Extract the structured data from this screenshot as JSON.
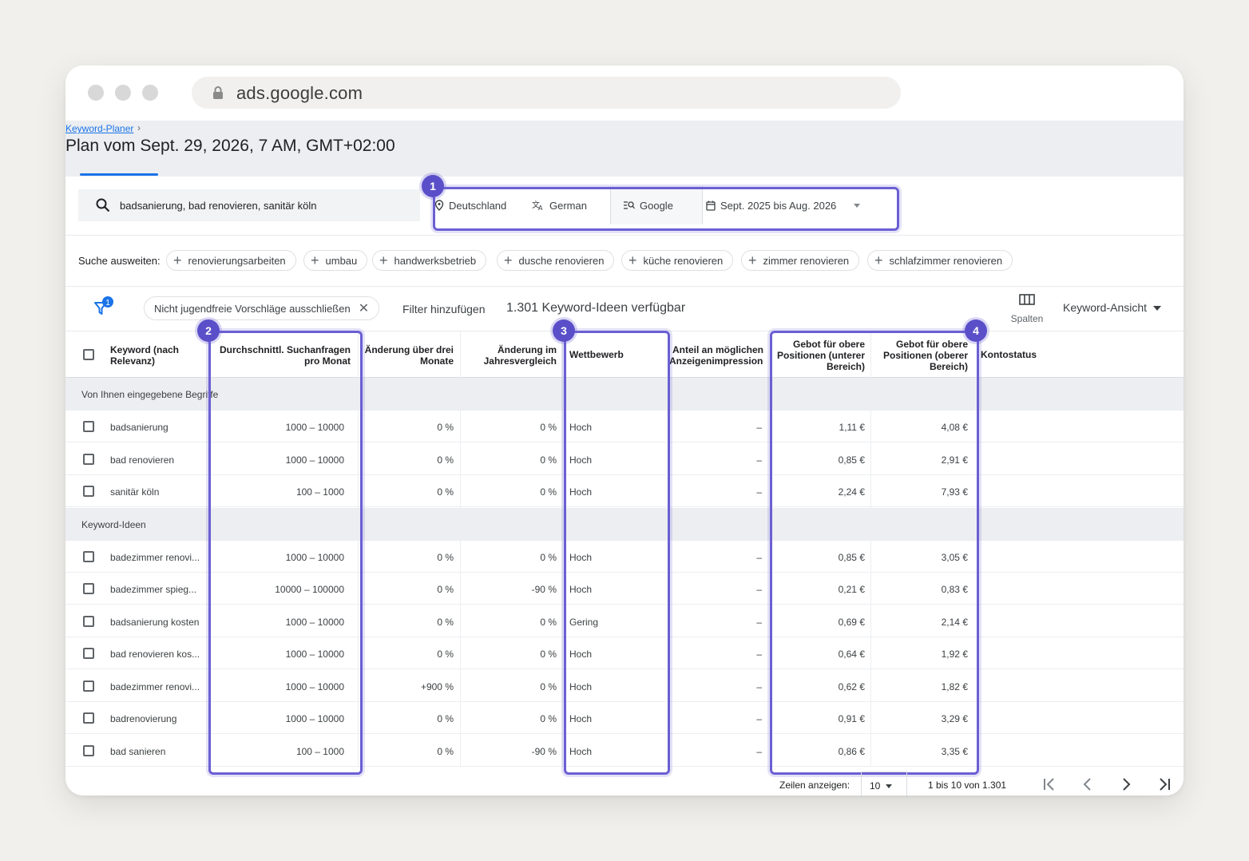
{
  "browser": {
    "url": "ads.google.com"
  },
  "breadcrumb": {
    "label": "Keyword-Planer",
    "arrow": "›"
  },
  "page": {
    "title": "Plan vom Sept. 29, 2026, 7 AM, GMT+02:00"
  },
  "search": {
    "query": "badsanierung, bad renovieren, sanitär köln"
  },
  "targeting": {
    "location": "Deutschland",
    "language": "German",
    "network": "Google",
    "date_range": "Sept. 2025 bis Aug. 2026"
  },
  "expand": {
    "label": "Suche ausweiten:",
    "chips": [
      "renovierungsarbeiten",
      "umbau",
      "handwerksbetrieb",
      "dusche renovieren",
      "küche renovieren",
      "zimmer renovieren",
      "schlafzimmer renovieren"
    ]
  },
  "filters": {
    "count": "1",
    "active_filter": "Nicht jugendfreie Vorschläge ausschließen",
    "add_filter": "Filter hinzufügen",
    "available": "1.301 Keyword-Ideen verfügbar",
    "columns_label": "Spalten",
    "view_label": "Keyword-Ansicht"
  },
  "table": {
    "headers": {
      "keyword": [
        "Keyword (nach",
        "Relevanz)"
      ],
      "searches": [
        "Durchschnittl. Suchanfragen",
        "pro Monat"
      ],
      "change3": [
        "Änderung über drei",
        "Monate"
      ],
      "yoy": [
        "Änderung im",
        "Jahresvergleich"
      ],
      "competition": [
        "Wettbewerb"
      ],
      "share": [
        "Anteil an möglichen",
        "Anzeigenimpressionen"
      ],
      "bid_low": [
        "Gebot für obere",
        "Positionen (unterer",
        "Bereich)"
      ],
      "bid_high": [
        "Gebot für obere",
        "Positionen (oberer",
        "Bereich)"
      ],
      "status": [
        "Kontostatus"
      ]
    },
    "sections": [
      {
        "label": "Von Ihnen eingegebene Begriffe",
        "rows": [
          {
            "keyword": "badsanierung",
            "searches": "1000 – 10000",
            "change3": "0 %",
            "yoy": "0 %",
            "competition": "Hoch",
            "share": "–",
            "bid_low": "1,11 €",
            "bid_high": "4,08 €"
          },
          {
            "keyword": "bad renovieren",
            "searches": "1000 – 10000",
            "change3": "0 %",
            "yoy": "0 %",
            "competition": "Hoch",
            "share": "–",
            "bid_low": "0,85 €",
            "bid_high": "2,91 €"
          },
          {
            "keyword": "sanitär köln",
            "searches": "100 – 1000",
            "change3": "0 %",
            "yoy": "0 %",
            "competition": "Hoch",
            "share": "–",
            "bid_low": "2,24 €",
            "bid_high": "7,93 €"
          }
        ]
      },
      {
        "label": "Keyword-Ideen",
        "rows": [
          {
            "keyword": "badezimmer renovi...",
            "searches": "1000 – 10000",
            "change3": "0 %",
            "yoy": "0 %",
            "competition": "Hoch",
            "share": "–",
            "bid_low": "0,85 €",
            "bid_high": "3,05 €"
          },
          {
            "keyword": "badezimmer spieg...",
            "searches": "10000 – 100000",
            "change3": "0 %",
            "yoy": "-90 %",
            "competition": "Hoch",
            "share": "–",
            "bid_low": "0,21 €",
            "bid_high": "0,83 €"
          },
          {
            "keyword": "badsanierung kosten",
            "searches": "1000 – 10000",
            "change3": "0 %",
            "yoy": "0 %",
            "competition": "Gering",
            "share": "–",
            "bid_low": "0,69 €",
            "bid_high": "2,14 €"
          },
          {
            "keyword": "bad renovieren kos...",
            "searches": "1000 – 10000",
            "change3": "0 %",
            "yoy": "0 %",
            "competition": "Hoch",
            "share": "–",
            "bid_low": "0,64 €",
            "bid_high": "1,92 €"
          },
          {
            "keyword": "badezimmer renovi...",
            "searches": "1000 – 10000",
            "change3": "+900 %",
            "yoy": "0 %",
            "competition": "Hoch",
            "share": "–",
            "bid_low": "0,62 €",
            "bid_high": "1,82 €"
          },
          {
            "keyword": "badrenovierung",
            "searches": "1000 – 10000",
            "change3": "0 %",
            "yoy": "0 %",
            "competition": "Hoch",
            "share": "–",
            "bid_low": "0,91 €",
            "bid_high": "3,29 €"
          },
          {
            "keyword": "bad sanieren",
            "searches": "100 – 1000",
            "change3": "0 %",
            "yoy": "-90 %",
            "competition": "Hoch",
            "share": "–",
            "bid_low": "0,86 €",
            "bid_high": "3,35 €"
          }
        ]
      }
    ]
  },
  "pagination": {
    "rows_label": "Zeilen anzeigen:",
    "rows_value": "10",
    "range": "1 bis 10 von 1.301"
  },
  "annotations": [
    "1",
    "2",
    "3",
    "4"
  ],
  "colors": {
    "highlight": "#6b5fd3",
    "badge": "#5b4fc9",
    "link": "#1a73e8"
  }
}
